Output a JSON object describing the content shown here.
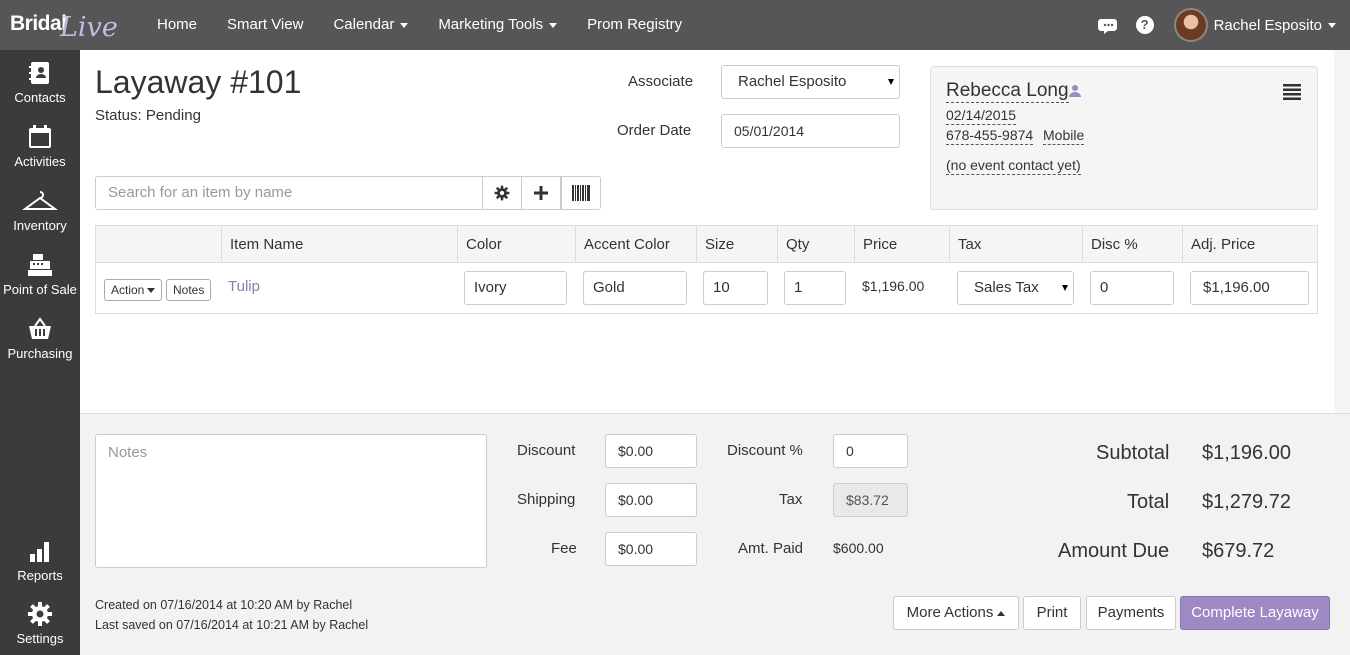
{
  "app": {
    "logo_part1": "Bridal",
    "logo_part2": "Live"
  },
  "nav": {
    "items": [
      {
        "label": "Home"
      },
      {
        "label": "Smart View"
      },
      {
        "label": "Calendar"
      },
      {
        "label": "Marketing Tools"
      },
      {
        "label": "Prom Registry"
      }
    ],
    "user_name": "Rachel Esposito",
    "help_label": "?"
  },
  "sidebar": {
    "items": [
      {
        "label": "Contacts",
        "icon": "contacts-book-icon"
      },
      {
        "label": "Activities",
        "icon": "calendar-icon"
      },
      {
        "label": "Inventory",
        "icon": "hanger-icon"
      },
      {
        "label": "Point of Sale",
        "icon": "cash-register-icon"
      },
      {
        "label": "Purchasing",
        "icon": "basket-icon"
      },
      {
        "label": "Reports",
        "icon": "bar-chart-icon"
      },
      {
        "label": "Settings",
        "icon": "gear-icon"
      }
    ]
  },
  "order": {
    "title": "Layaway #101",
    "status": "Status: Pending",
    "associate_label": "Associate",
    "associate_value": "Rachel Esposito",
    "date_label": "Order Date",
    "date_value": "05/01/2014"
  },
  "contact": {
    "name": "Rebecca Long",
    "date": "02/14/2015",
    "phone": "678-455-9874",
    "phone_type": "Mobile",
    "event_contact": "(no event contact yet)"
  },
  "search": {
    "placeholder": "Search for an item by name"
  },
  "table": {
    "headers": [
      "Item Name",
      "Color",
      "Accent Color",
      "Size",
      "Qty",
      "Price",
      "Tax",
      "Disc %",
      "Adj. Price"
    ],
    "row": {
      "action_label": "Action",
      "notes_label": "Notes",
      "item_name": "Tulip",
      "color": "Ivory",
      "accent_color": "Gold",
      "size": "10",
      "qty": "1",
      "price": "$1,196.00",
      "tax": "Sales Tax",
      "disc": "0",
      "adj_price": "$1,196.00"
    }
  },
  "footer": {
    "notes_placeholder": "Notes",
    "discount_label": "Discount",
    "discount_value": "$0.00",
    "shipping_label": "Shipping",
    "shipping_value": "$0.00",
    "fee_label": "Fee",
    "fee_value": "$0.00",
    "discount_pct_label": "Discount %",
    "discount_pct_value": "0",
    "tax_label": "Tax",
    "tax_value": "$83.72",
    "amt_paid_label": "Amt. Paid",
    "amt_paid_value": "$600.00",
    "subtotal_label": "Subtotal",
    "subtotal_value": "$1,196.00",
    "total_label": "Total",
    "total_value": "$1,279.72",
    "amount_due_label": "Amount Due",
    "amount_due_value": "$679.72",
    "created_text": "Created on 07/16/2014 at 10:20 AM by Rachel",
    "saved_text": "Last saved on 07/16/2014 at 10:21 AM by Rachel",
    "more_actions_label": "More Actions",
    "print_label": "Print",
    "payments_label": "Payments",
    "complete_label": "Complete Layaway"
  },
  "colors": {
    "accent": "#9d89c4",
    "topbar": "#565656",
    "sidebar": "#3b3b3b",
    "link": "#8f7bb5"
  }
}
